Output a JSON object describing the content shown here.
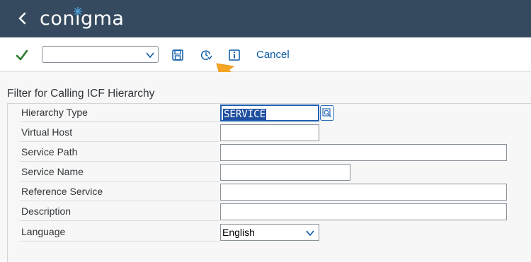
{
  "header": {
    "logo_text": "conigma",
    "bg_color": "#354a5f"
  },
  "toolbar": {
    "command_value": "",
    "cancel_label": "Cancel",
    "icons": [
      "check-icon",
      "save-icon",
      "clock-variant-icon",
      "info-icon"
    ]
  },
  "form": {
    "title": "Filter for Calling ICF Hierarchy",
    "fields": [
      {
        "label": "Hierarchy Type",
        "value": "SERVICE"
      },
      {
        "label": "Virtual Host",
        "value": ""
      },
      {
        "label": "Service Path",
        "value": ""
      },
      {
        "label": "Service Name",
        "value": ""
      },
      {
        "label": "Reference Service",
        "value": ""
      },
      {
        "label": "Description",
        "value": ""
      },
      {
        "label": "Language",
        "value": "English"
      }
    ]
  },
  "colors": {
    "accent": "#0a5aa6",
    "check": "#2b7a2b",
    "arrow": "#f5a623",
    "selection": "#1f4fa0"
  }
}
